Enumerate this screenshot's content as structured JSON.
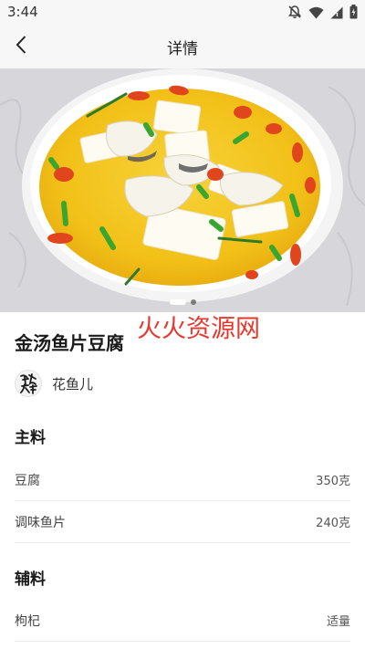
{
  "status": {
    "time": "3:44",
    "icons": [
      "notifications-off-icon",
      "wifi-icon",
      "signal-icon",
      "battery-icon"
    ]
  },
  "nav": {
    "title": "详情",
    "back_icon": "chevron-left-icon"
  },
  "carousel": {
    "total": 2,
    "active_index": 0
  },
  "watermark": "火火资源网",
  "recipe": {
    "title": "金汤鱼片豆腐",
    "author": "花鱼儿",
    "avatar_text": "钱 杏"
  },
  "main_ingredients": {
    "title": "主料",
    "items": [
      {
        "name": "豆腐",
        "amount": "350克"
      },
      {
        "name": "调味鱼片",
        "amount": "240克"
      }
    ]
  },
  "side_ingredients": {
    "title": "辅料",
    "items": [
      {
        "name": "枸杞",
        "amount": "适量"
      }
    ]
  },
  "colors": {
    "accent_red": "#e8382e",
    "soup_yellow": "#f2c118"
  }
}
